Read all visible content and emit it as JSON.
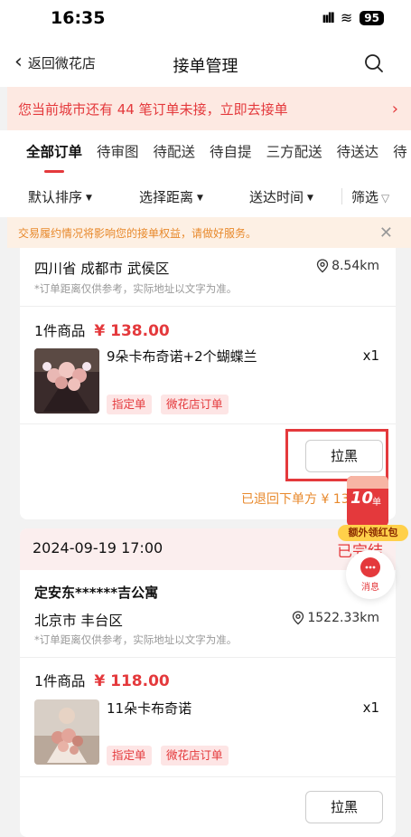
{
  "status_bar": {
    "time": "16:35",
    "battery": "95"
  },
  "nav": {
    "back_label": "返回微花店",
    "title": "接单管理"
  },
  "banner": {
    "text": "您当前城市还有 44 笔订单未接，立即去接单",
    "arrow": "›"
  },
  "tabs": [
    "全部订单",
    "待审图",
    "待配送",
    "待自提",
    "三方配送",
    "待送达",
    "待"
  ],
  "filters": {
    "sort": "默认排序",
    "distance": "选择距离",
    "delivery_time": "送达时间",
    "screen": "筛选"
  },
  "notice": {
    "text": "交易履约情况将影响您的接单权益，请做好服务。",
    "close": "✕"
  },
  "orders": [
    {
      "city": "四川省 成都市 武侯区",
      "distance": "8.54km",
      "addr_note": "*订单距离仅供参考，实际地址以文字为准。",
      "goods_count": "1件商品",
      "price": "¥ 138.00",
      "item_name": "9朵卡布奇诺+2个蝴蝶兰",
      "qty": "x1",
      "tags": [
        "指定单",
        "微花店订单"
      ],
      "action": "拉黑",
      "refund_text": "已退回下单方 ¥ 13"
    },
    {
      "time": "2024-09-19 17:00",
      "status": "已完结",
      "recipient": "定安东******吉公寓",
      "city": "北京市 丰台区",
      "distance": "1522.33km",
      "addr_note": "*订单距离仅供参考，实际地址以文字为准。",
      "goods_count": "1件商品",
      "price": "¥ 118.00",
      "item_name": "11朵卡布奇诺",
      "qty": "x1",
      "tags": [
        "指定单",
        "微花店订单"
      ],
      "action": "拉黑"
    }
  ],
  "redpack": {
    "count": "10",
    "unit": "单",
    "label": "额外领红包"
  },
  "message": {
    "label": "消息"
  },
  "colors": {
    "accent": "#e4393c",
    "warning": "#e8892c",
    "banner_bg": "#fde9e2"
  }
}
